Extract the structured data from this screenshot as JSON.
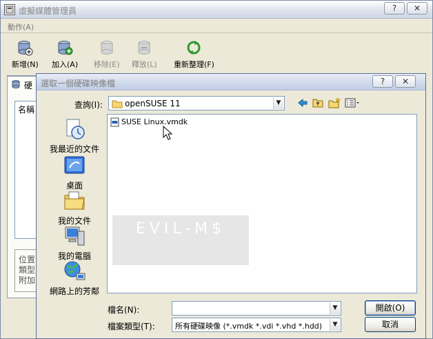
{
  "window": {
    "title": "虛擬媒體管理員",
    "caption_help": "?",
    "caption_close": "✕"
  },
  "menu": {
    "actions": "動作(A)"
  },
  "toolbar": {
    "new": "新增(N)",
    "add": "加入(A)",
    "remove": "移除(E)",
    "release": "釋放(L)",
    "refresh": "重新整理(F)"
  },
  "tabs": {
    "hard_disk": "硬"
  },
  "list": {
    "name_header": "名稱"
  },
  "info": {
    "location": "位置",
    "type": "類型",
    "attached": "附加"
  },
  "dialog": {
    "title": "選取一個硬碟映像檔",
    "caption_help": "?",
    "caption_close": "✕",
    "look_in_label": "查詢(I):",
    "look_in_value": "openSUSE 11",
    "places": {
      "recent": "我最近的文件",
      "desktop": "桌面",
      "documents": "我的文件",
      "computer": "我的電腦",
      "network": "網路上的芳鄰"
    },
    "files": [
      {
        "name": "SUSE Linux.vmdk"
      }
    ],
    "filename_label": "檔名(N):",
    "filename_value": "",
    "filetype_label": "檔案類型(T):",
    "filetype_value": "所有硬碟映像 (*.vmdk *.vdi *.vhd *.hdd)",
    "open_button": "開啟(O)",
    "cancel_button": "取消"
  },
  "watermark": "EVIL-M$",
  "colors": {
    "title_gradient_start": "#ffffff",
    "dialog_title": "#cdd8ea",
    "button_border": "#003c74",
    "field_border": "#7f9db9",
    "window_bg": "#ece9d8"
  }
}
